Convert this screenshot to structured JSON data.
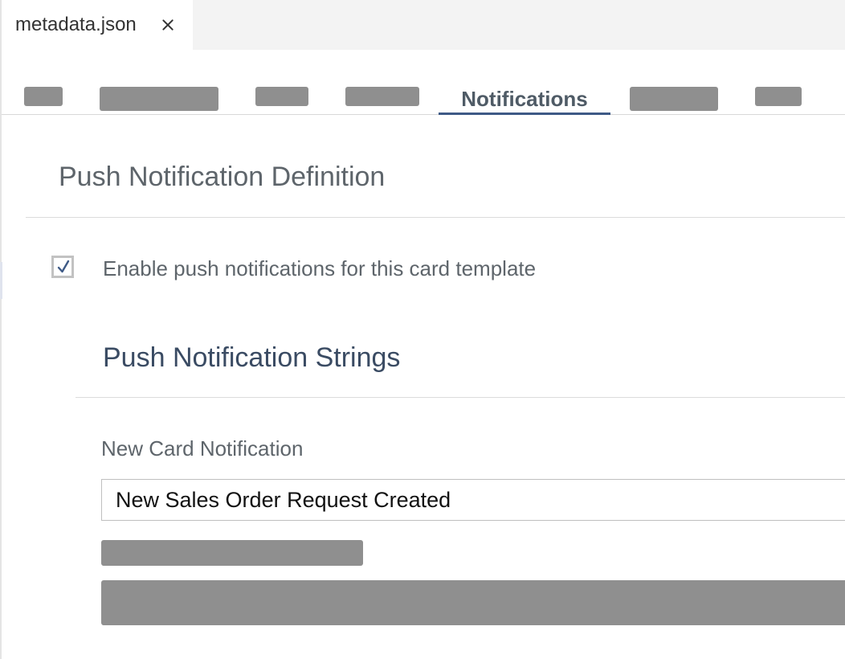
{
  "editor_tab": {
    "label": "metadata.json"
  },
  "section_tabs": [
    {
      "label": "",
      "redacted": true
    },
    {
      "label": "",
      "redacted": true
    },
    {
      "label": "",
      "redacted": true
    },
    {
      "label": "",
      "redacted": true
    },
    {
      "label": "Notifications",
      "active": true
    },
    {
      "label": "",
      "redacted": true
    },
    {
      "label": "",
      "redacted": true
    }
  ],
  "push_definition": {
    "title": "Push Notification Definition",
    "enable_checkbox": {
      "label": "Enable push notifications for this card template",
      "checked": true
    }
  },
  "push_strings": {
    "title": "Push Notification Strings",
    "new_card_notification": {
      "label": "New Card Notification",
      "value": "New Sales Order Request Created"
    }
  },
  "colors": {
    "accent": "#3e5a86",
    "redaction": "#8f8f8f",
    "heading_text": "#5e656b",
    "subheading_text": "#3a4b63"
  },
  "icons": {
    "close": "close-icon",
    "check": "check-icon"
  }
}
